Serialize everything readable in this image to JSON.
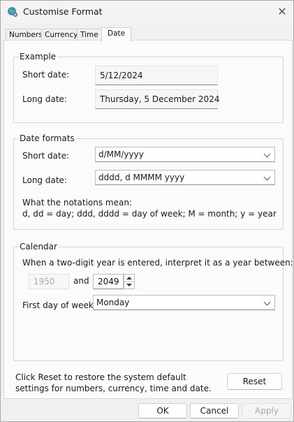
{
  "window": {
    "title": "Customise Format",
    "close_glyph": "✕"
  },
  "tabs": [
    {
      "label": "Numbers",
      "active": false
    },
    {
      "label": "Currency",
      "active": false
    },
    {
      "label": "Time",
      "active": false
    },
    {
      "label": "Date",
      "active": true
    }
  ],
  "example": {
    "legend": "Example",
    "short_label": "Short date:",
    "short_value": "5/12/2024",
    "long_label": "Long date:",
    "long_value": "Thursday, 5 December 2024"
  },
  "formats": {
    "legend": "Date formats",
    "short_label": "Short date:",
    "short_value": "d/MM/yyyy",
    "long_label": "Long date:",
    "long_value": "dddd, d MMMM yyyy",
    "notation_title": "What the notations mean:",
    "notation_text": "d, dd = day;  ddd, dddd = day of week;  M = month;  y = year"
  },
  "calendar": {
    "legend": "Calendar",
    "two_digit_text": "When a two-digit year is entered, interpret it as a year between:",
    "year_from": "1950",
    "and_label": "and",
    "year_to": "2049",
    "first_day_label": "First day of week:",
    "first_day_value": "Monday"
  },
  "reset": {
    "text": "Click Reset to restore the system default settings for numbers, currency, time and date.",
    "button": "Reset"
  },
  "footer": {
    "ok": "OK",
    "cancel": "Cancel",
    "apply": "Apply"
  },
  "icons": {
    "app": "globe-gear-icon",
    "close": "close-icon",
    "dropdown": "chevron-down-icon"
  }
}
